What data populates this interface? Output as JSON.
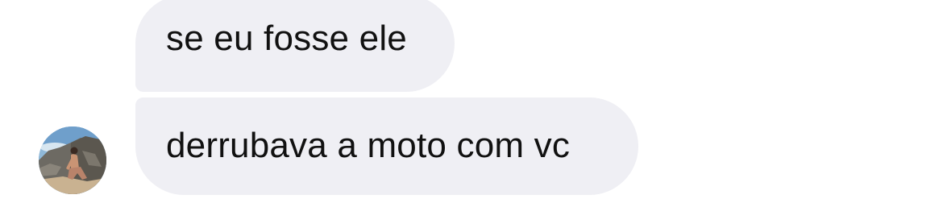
{
  "thread": {
    "messages": [
      {
        "text": "se eu fosse ele",
        "direction": "incoming"
      },
      {
        "text": "derrubava a moto com vc",
        "direction": "incoming"
      }
    ],
    "sender": {
      "avatar_icon": "profile-photo"
    }
  },
  "colors": {
    "background": "#ffffff",
    "incoming_bubble": "#efeff4",
    "message_text": "#111111"
  }
}
